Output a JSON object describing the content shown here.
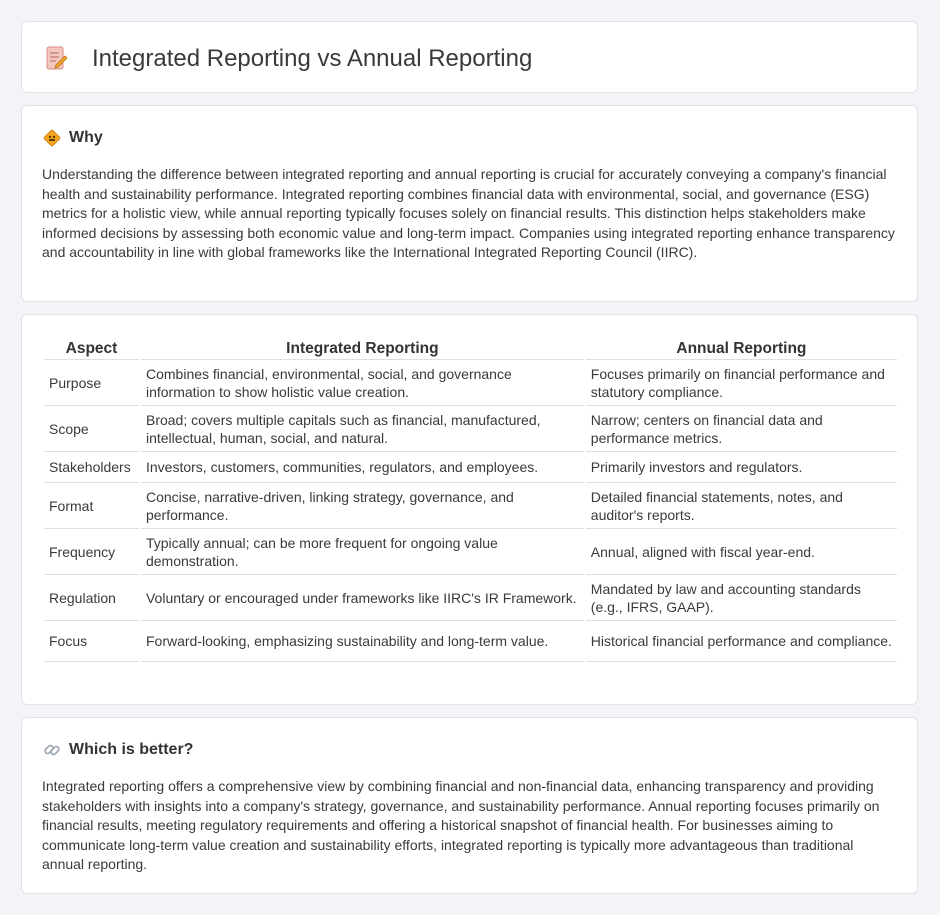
{
  "header": {
    "title": "Integrated Reporting vs Annual Reporting",
    "icon": "document-pencil-icon"
  },
  "why": {
    "icon": "caution-sign-icon",
    "title": "Why",
    "text": "Understanding the difference between integrated reporting and annual reporting is crucial for accurately conveying a company's financial health and sustainability performance. Integrated reporting combines financial data with environmental, social, and governance (ESG) metrics for a holistic view, while annual reporting typically focuses solely on financial results. This distinction helps stakeholders make informed decisions by assessing both economic value and long-term impact. Companies using integrated reporting enhance transparency and accountability in line with global frameworks like the International Integrated Reporting Council (IIRC)."
  },
  "table": {
    "headers": [
      "Aspect",
      "Integrated Reporting",
      "Annual Reporting"
    ],
    "rows": [
      [
        "Purpose",
        "Combines financial, environmental, social, and governance information to show holistic value creation.",
        "Focuses primarily on financial performance and statutory compliance."
      ],
      [
        "Scope",
        "Broad; covers multiple capitals such as financial, manufactured, intellectual, human, social, and natural.",
        "Narrow; centers on financial data and performance metrics."
      ],
      [
        "Stakeholders",
        "Investors, customers, communities, regulators, and employees.",
        "Primarily investors and regulators."
      ],
      [
        "Format",
        "Concise, narrative-driven, linking strategy, governance, and performance.",
        "Detailed financial statements, notes, and auditor's reports."
      ],
      [
        "Frequency",
        "Typically annual; can be more frequent for ongoing value demonstration.",
        "Annual, aligned with fiscal year-end."
      ],
      [
        "Regulation",
        "Voluntary or encouraged under frameworks like IIRC's IR Framework.",
        "Mandated by law and accounting standards (e.g., IFRS, GAAP)."
      ],
      [
        "Focus",
        "Forward-looking, emphasizing sustainability and long-term value.",
        "Historical financial performance and compliance."
      ]
    ]
  },
  "better": {
    "icon": "link-icon",
    "title": "Which is better?",
    "text": "Integrated reporting offers a comprehensive view by combining financial and non-financial data, enhancing transparency and providing stakeholders with insights into a company's strategy, governance, and sustainability performance. Annual reporting focuses primarily on financial results, meeting regulatory requirements and offering a historical snapshot of financial health. For businesses aiming to communicate long-term value creation and sustainability efforts, integrated reporting is typically more advantageous than traditional annual reporting."
  },
  "colors": {
    "background": "#f3f4f7",
    "card": "#ffffff",
    "border": "#e2e4e8",
    "accent_orange": "#f5a623",
    "icon_pink": "#e58b8b"
  }
}
